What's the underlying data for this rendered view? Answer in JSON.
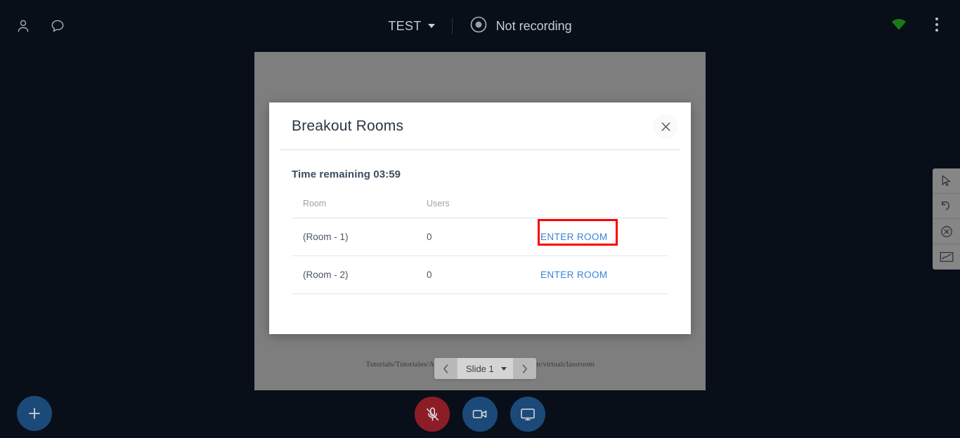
{
  "topbar": {
    "left_icons": [
      {
        "name": "user-icon",
        "label": "Users"
      },
      {
        "name": "chat-icon",
        "label": "Chat"
      }
    ],
    "meeting_title": "TEST",
    "recording_status": "Not recording",
    "record_icon": "record-circle-icon",
    "signal_icon": "signal-strength-icon",
    "signal_color": "#1a7a1a",
    "kebab_icon": "more-options-icon"
  },
  "presentation": {
    "slide_text": "Tutorials/Tutoriales/Anleitungen/https://bongolearn.com/virtualclassroom",
    "slide_text_left": "Tutorials/Tutoriales/Anleitungen/",
    "slide_text_right": "bongolearn.com/virtualclassroom",
    "nav": {
      "prev_label": "Previous slide",
      "next_label": "Next slide",
      "current_slide": "Slide 1"
    }
  },
  "right_toolbar": {
    "items": [
      {
        "name": "pointer-tool",
        "label": "Pointer"
      },
      {
        "name": "undo-tool",
        "label": "Undo"
      },
      {
        "name": "clear-tool",
        "label": "Clear all"
      },
      {
        "name": "whiteboard-tool",
        "label": "Whiteboard"
      }
    ]
  },
  "bottom_bar": {
    "add_label": "Add",
    "buttons": [
      {
        "name": "mute-microphone-button",
        "label": "Microphone muted",
        "color": "#8c1d26"
      },
      {
        "name": "webcam-button",
        "label": "Share webcam",
        "color": "#1b4a79"
      },
      {
        "name": "screenshare-button",
        "label": "Share screen",
        "color": "#1b4a79"
      }
    ]
  },
  "modal": {
    "title": "Breakout Rooms",
    "close_label": "Close",
    "time_remaining": "Time remaining 03:59",
    "table": {
      "columns": [
        "Room",
        "Users",
        ""
      ],
      "rows": [
        {
          "room": "(Room - 1)",
          "users": "0",
          "action": "ENTER ROOM",
          "highlighted": true
        },
        {
          "room": "(Room - 2)",
          "users": "0",
          "action": "ENTER ROOM",
          "highlighted": false
        }
      ]
    }
  },
  "colors": {
    "app_background": "#080f19",
    "presentation_background": "#7e7e7e",
    "modal_background": "#ffffff",
    "link_blue": "#3b82d6",
    "highlight_red": "#fa0000",
    "accent_blue": "#1b4a79",
    "danger_red": "#8c1d26"
  }
}
